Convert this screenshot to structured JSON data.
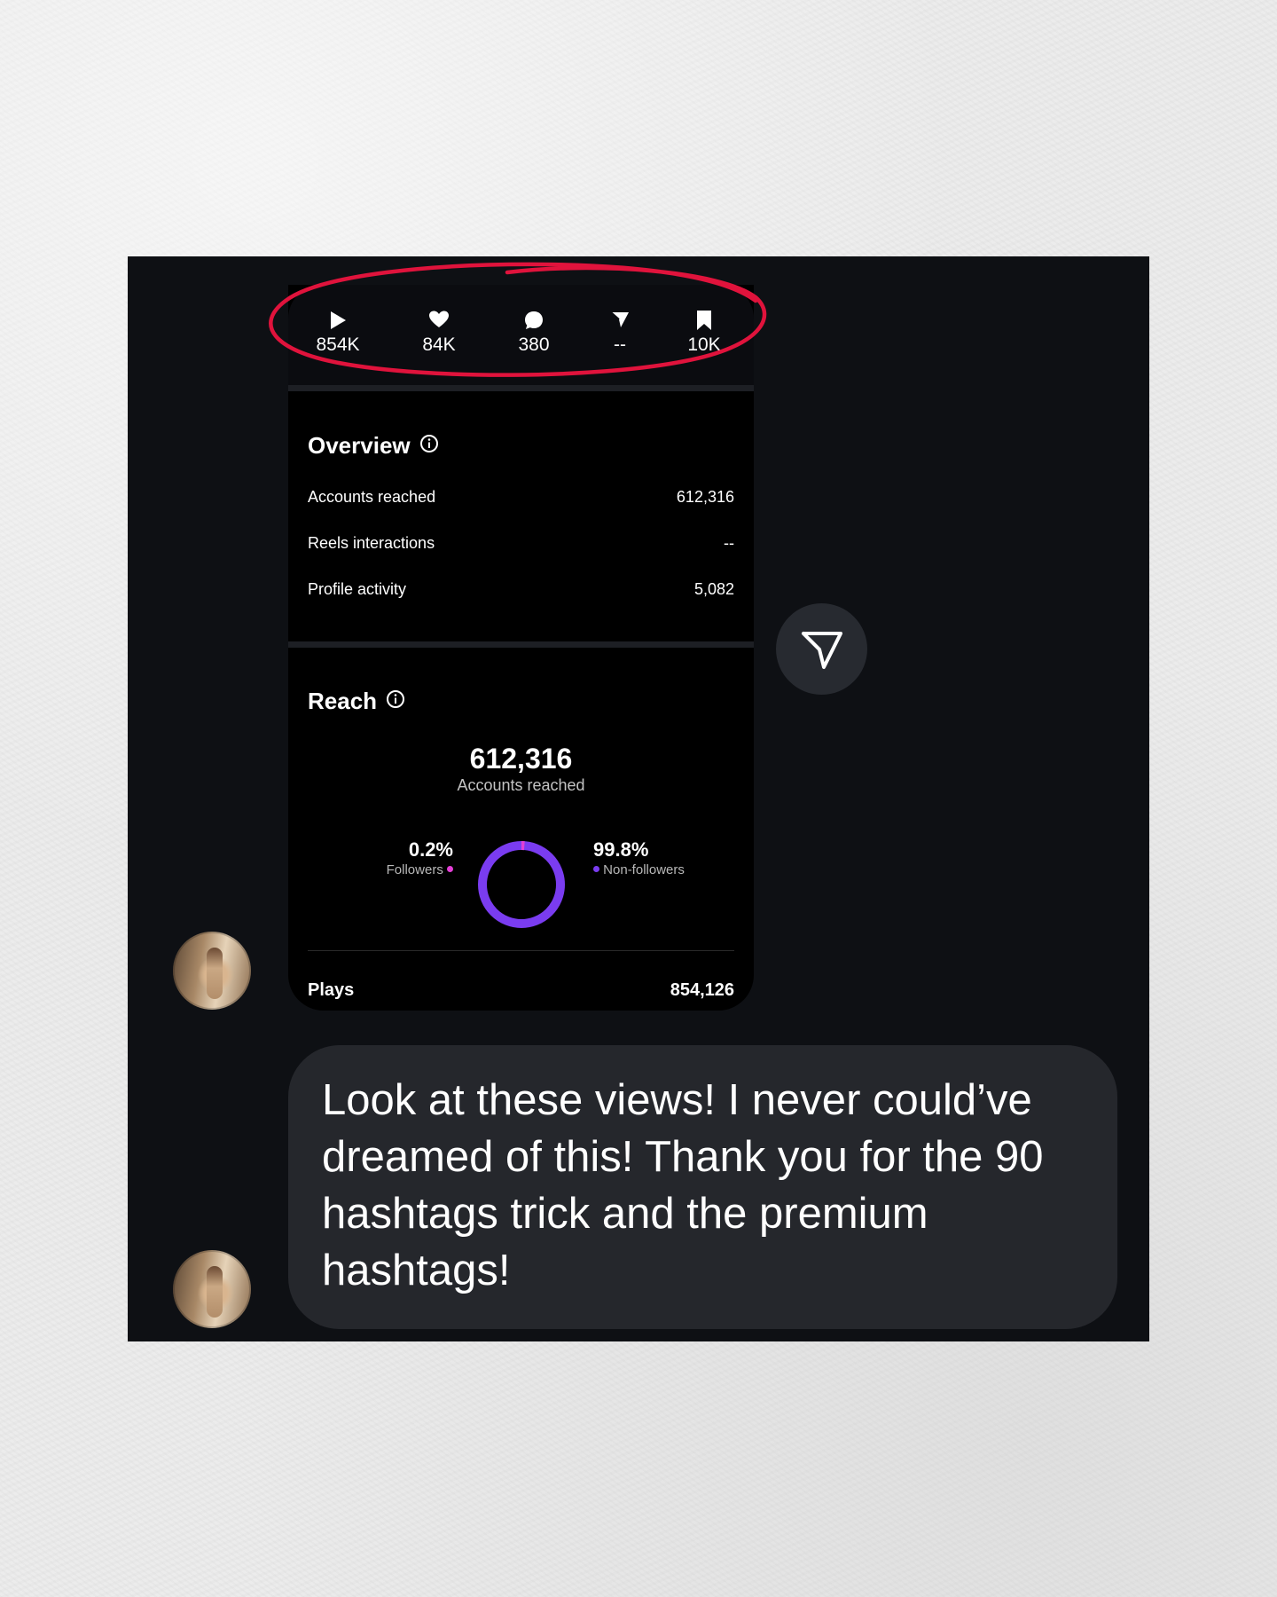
{
  "post_stats": [
    {
      "icon": "play-icon",
      "value": "854K"
    },
    {
      "icon": "heart-icon",
      "value": "84K"
    },
    {
      "icon": "comment-icon",
      "value": "380"
    },
    {
      "icon": "send-icon",
      "value": "--"
    },
    {
      "icon": "bookmark-icon",
      "value": "10K"
    }
  ],
  "overview": {
    "title": "Overview",
    "rows": [
      {
        "label": "Accounts reached",
        "value": "612,316"
      },
      {
        "label": "Reels interactions",
        "value": "--"
      },
      {
        "label": "Profile activity",
        "value": "5,082"
      }
    ]
  },
  "reach": {
    "title": "Reach",
    "total": "612,316",
    "total_label": "Accounts reached",
    "followers_pct": "0.2%",
    "followers_label": "Followers",
    "followers_fraction": 0.002,
    "nonfollowers_pct": "99.8%",
    "nonfollowers_label": "Non-followers",
    "nonfollowers_fraction": 0.998,
    "followers_color": "#e33fd6",
    "nonfollowers_color": "#7a3cf0"
  },
  "plays": {
    "label": "Plays",
    "value": "854,126"
  },
  "message": {
    "text": "Look at these views! I never could’ve dreamed of this! Thank you for the 90 hashtags trick and the premium hashtags!"
  },
  "colors": {
    "annotation_circle": "#e0133c",
    "bubble": "#25272c",
    "background": "#0e1014"
  }
}
